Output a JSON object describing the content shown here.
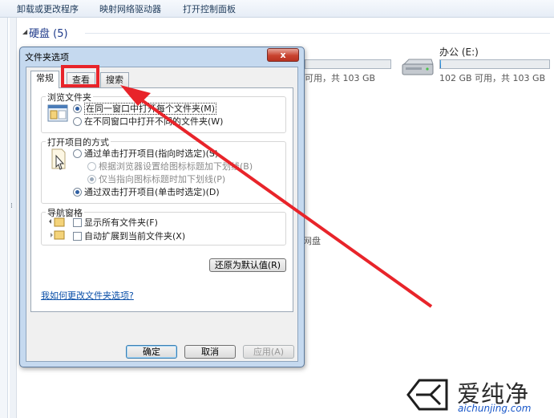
{
  "toolbar": {
    "items": [
      "卸载或更改程序",
      "映射网络驱动器",
      "打开控制面板"
    ]
  },
  "explorer": {
    "section_title": "硬盘 (5)",
    "drive_left_text": "可用，共 103 GB",
    "drive_right": {
      "name": "办公 (E:)",
      "space_text": "102 GB 可用，共 103 GB",
      "used_fraction": 0.01
    },
    "network_label": "网盘"
  },
  "dialog": {
    "title": "文件夹选项",
    "close_glyph": "x",
    "tabs": [
      "常规",
      "查看",
      "搜索"
    ],
    "browse_group": {
      "label": "浏览文件夹",
      "options": [
        "在同一窗口中打开每个文件夹(M)",
        "在不同窗口中打开不同的文件夹(W)"
      ]
    },
    "open_group": {
      "label": "打开项目的方式",
      "options": [
        "通过单击打开项目(指向时选定)(S)",
        "根据浏览器设置给图标标题加下划线(B)",
        "仅当指向图标标题时加下划线(P)",
        "通过双击打开项目(单击时选定)(D)"
      ]
    },
    "nav_group": {
      "label": "导航窗格",
      "options": [
        "显示所有文件夹(F)",
        "自动扩展到当前文件夹(X)"
      ]
    },
    "restore_button": "还原为默认值(R)",
    "help_link": "我如何更改文件夹选项?",
    "ok_button": "确定",
    "cancel_button": "取消",
    "apply_button": "应用(A)"
  },
  "watermark": {
    "cn": "爱纯净",
    "en": "aichunjing.com"
  },
  "colors": {
    "annotation_red": "#e8242a",
    "link_blue": "#0a4fa8",
    "watermark_blue": "#1a58c9"
  }
}
